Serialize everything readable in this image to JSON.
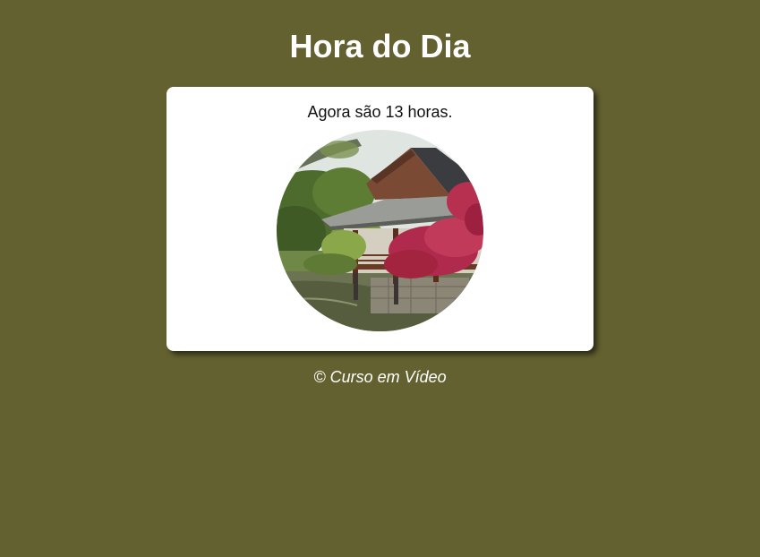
{
  "page": {
    "title": "Hora do Dia",
    "background_color": "#636130"
  },
  "card": {
    "hour_message": "Agora são 13 horas.",
    "image": {
      "semantic": "japanese-pavilion-by-pond-photo",
      "shape": "circle"
    }
  },
  "footer": {
    "text": "© Curso em Vídeo"
  }
}
